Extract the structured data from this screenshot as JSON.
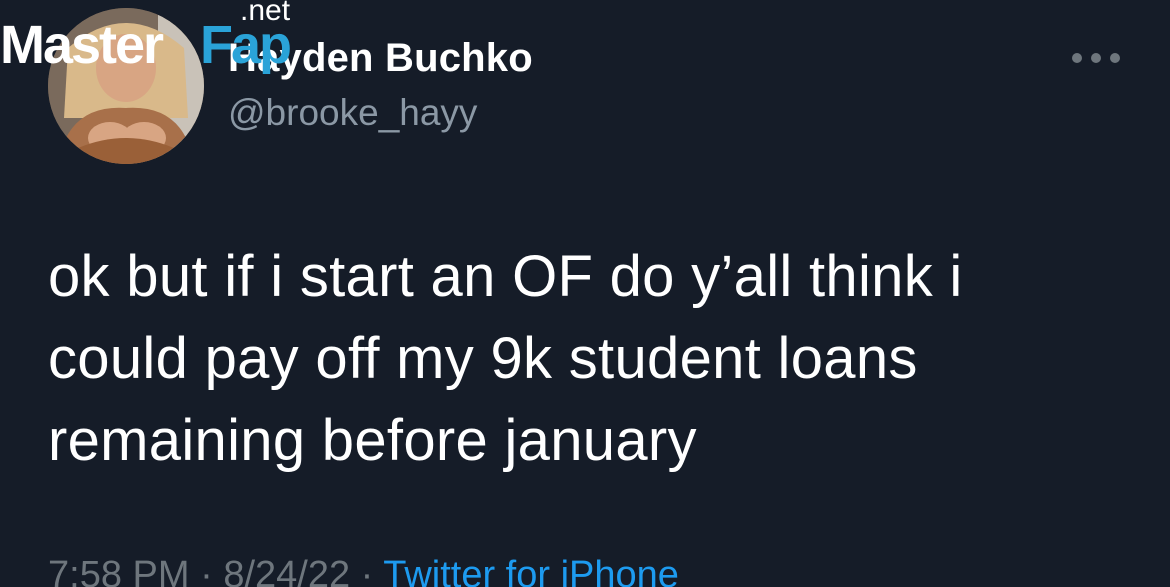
{
  "user": {
    "display_name": "Hayden Buchko",
    "handle": "@brooke_hayy"
  },
  "tweet": {
    "lines": [
      "ok but if i start an OF do y’all think i",
      "could pay off my 9k student loans",
      "remaining before january"
    ]
  },
  "meta": {
    "time": "7:58 PM",
    "separator": " · ",
    "date": "8/24/22",
    "source": "Twitter for iPhone"
  },
  "watermark": {
    "part1": "Master",
    "part2": "Fap",
    "suffix": ".net"
  },
  "icons": {
    "more": "more-horizontal-icon"
  },
  "colors": {
    "background": "#151c28",
    "text": "#ffffff",
    "secondary": "#8b98a5",
    "link": "#1d9bf0",
    "watermark_accent": "#2aa3d8"
  }
}
